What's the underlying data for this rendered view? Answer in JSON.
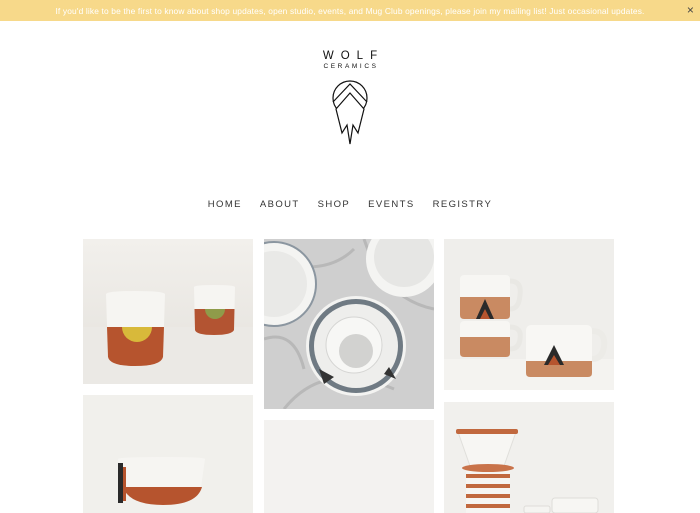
{
  "announcement": {
    "text": "If you'd like to be the first to know about shop updates, open studio, events, and Mug Club openings, please join my mailing list! Just occasional updates.",
    "close_label": "×"
  },
  "brand": {
    "title": "WOLF",
    "subtitle": "CERAMICS",
    "icon": "wolf-mountain-logo-icon"
  },
  "nav": {
    "items": [
      "HOME",
      "ABOUT",
      "SHOP",
      "EVENTS",
      "REGISTRY"
    ]
  },
  "gallery": {
    "items": [
      "two-cups-yellow-green-dots",
      "plates-bowl-marble",
      "stacked-mugs-triangles",
      "bowl-terracotta-band",
      "blank-white-photo",
      "pour-over-coffee-set"
    ]
  },
  "colors": {
    "banner": "#f7d98a",
    "terracotta": "#b6542e",
    "glaze_white": "#f3f2ee"
  }
}
